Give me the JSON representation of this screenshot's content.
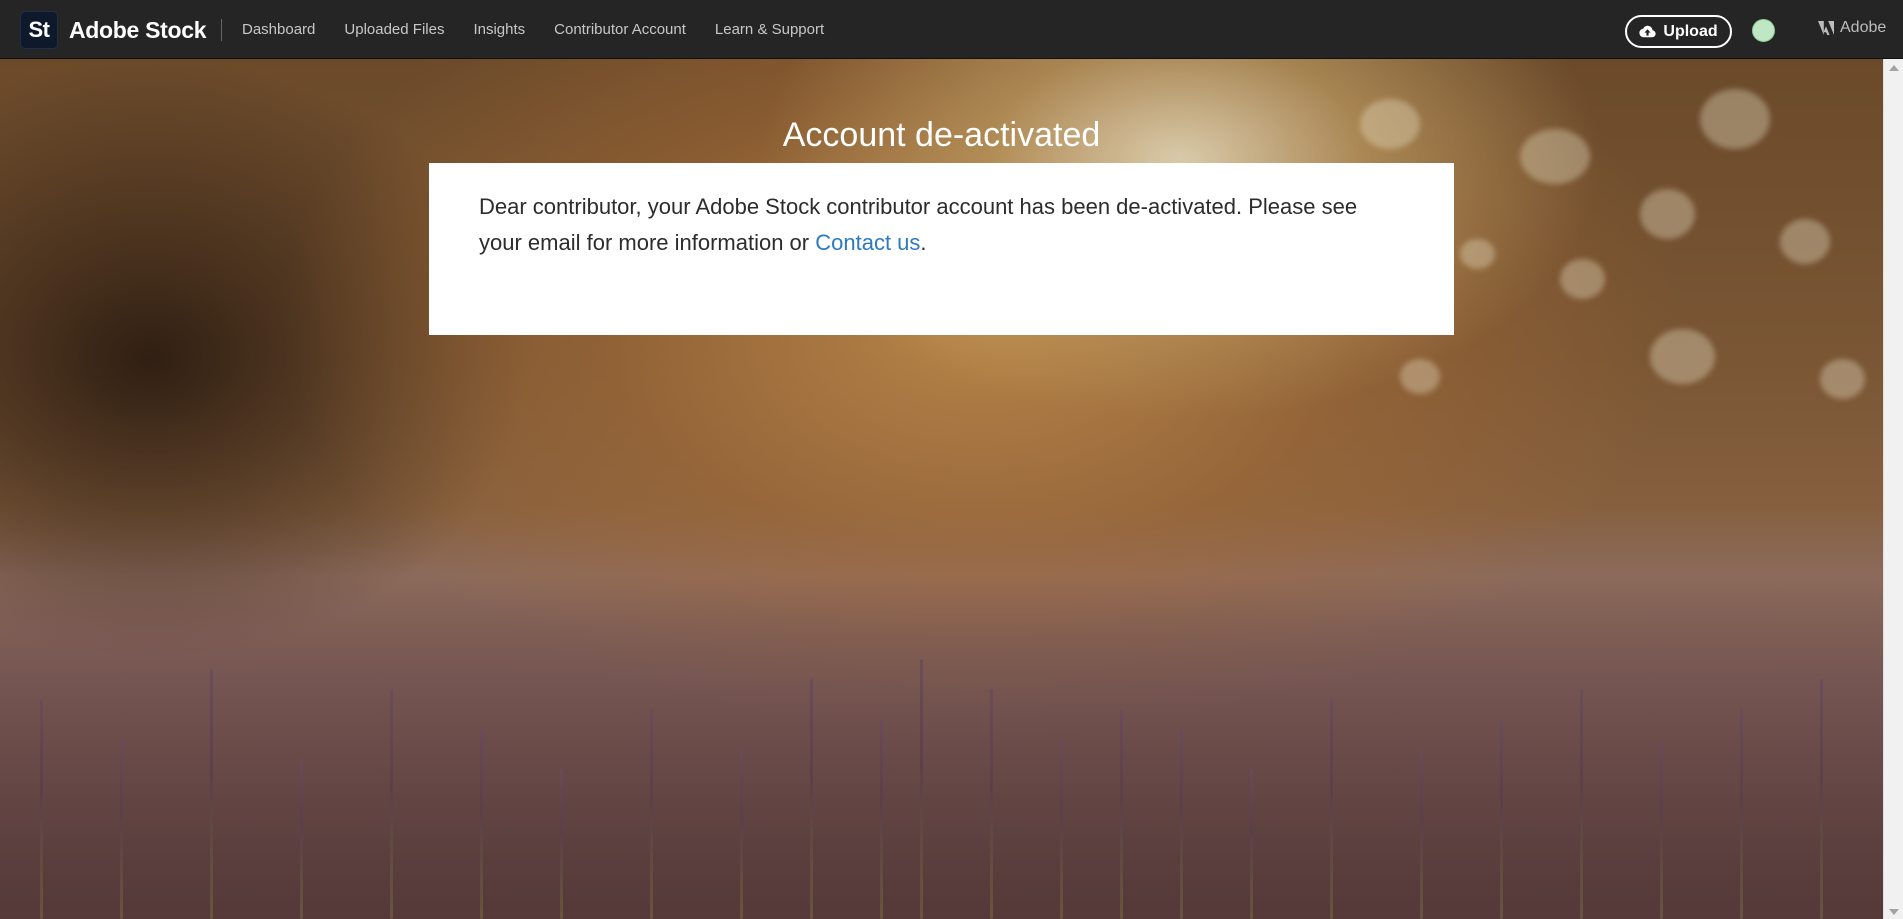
{
  "header": {
    "logo_mark": "St",
    "brand": "Adobe Stock",
    "nav": [
      {
        "label": "Dashboard"
      },
      {
        "label": "Uploaded Files"
      },
      {
        "label": "Insights"
      },
      {
        "label": "Contributor Account"
      },
      {
        "label": "Learn & Support"
      }
    ],
    "upload_label": "Upload",
    "upload_icon": "cloud-upload-icon",
    "adobe_label": "Adobe",
    "adobe_icon": "adobe-logo-icon"
  },
  "main": {
    "title": "Account de-activated",
    "message_before_link": "Dear contributor, your Adobe Stock contributor account has been de-activated. Please see your email for more information or ",
    "link_text": "Contact us",
    "message_after_link": "."
  },
  "colors": {
    "topbar": "#252525",
    "link": "#2d7ac0",
    "text": "#2c2c2c"
  }
}
